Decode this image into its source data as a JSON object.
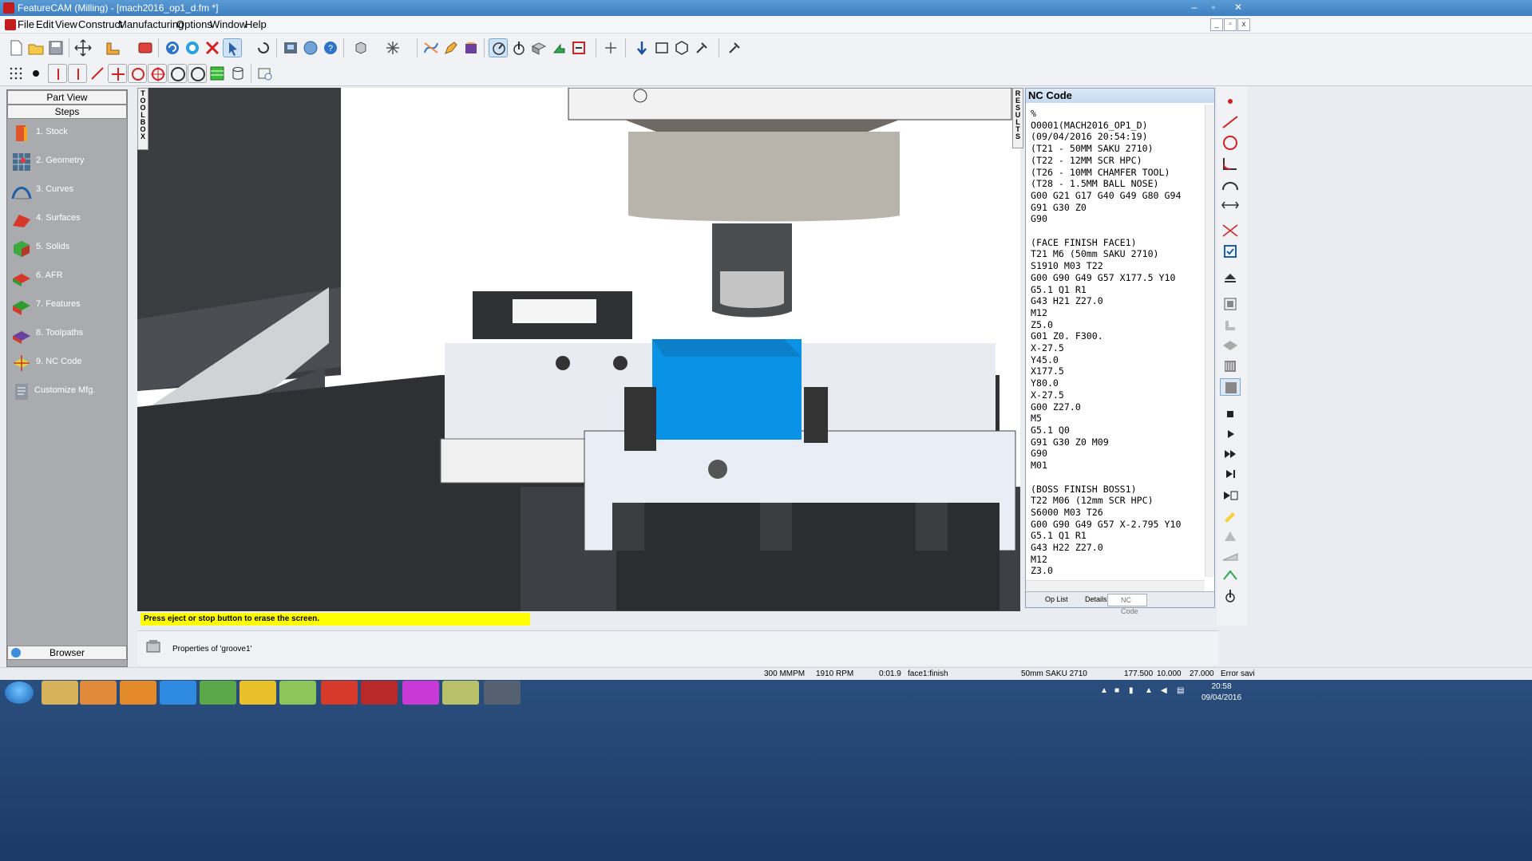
{
  "window": {
    "title": "FeatureCAM (Milling) - [mach2016_op1_d.fm *]",
    "controls": [
      "–",
      "▫",
      "✕"
    ]
  },
  "menu": {
    "items": [
      "File",
      "Edit",
      "View",
      "Construct",
      "Manufacturing",
      "Options",
      "Window",
      "Help"
    ],
    "mdi_controls": [
      "_",
      "▫",
      "x"
    ]
  },
  "left_panel": {
    "part_view": "Part View",
    "steps": "Steps",
    "items": [
      {
        "label": "1.  Stock",
        "icon": "stock-icon"
      },
      {
        "label": "2.  Geometry",
        "icon": "geometry-icon"
      },
      {
        "label": "3.  Curves",
        "icon": "curves-icon"
      },
      {
        "label": "4.  Surfaces",
        "icon": "surfaces-icon"
      },
      {
        "label": "5.  Solids",
        "icon": "solids-icon"
      },
      {
        "label": "6.  AFR",
        "icon": "afr-icon"
      },
      {
        "label": "7.  Features",
        "icon": "features-icon"
      },
      {
        "label": "8.  Toolpaths",
        "icon": "toolpaths-icon"
      },
      {
        "label": "9.  NC Code",
        "icon": "nc-code-icon"
      },
      {
        "label": "Customize Mfg.",
        "icon": "customize-icon"
      }
    ],
    "browser": "Browser"
  },
  "toolbox_tab": "TOOLBOX",
  "results_tab": "RESULTS",
  "nc_panel": {
    "title": "NC Code",
    "code": "%\nO0001(MACH2016_OP1_D)\n(09/04/2016 20:54:19)\n(T21 - 50MM SAKU 2710)\n(T22 - 12MM SCR HPC)\n(T26 - 10MM CHAMFER TOOL)\n(T28 - 1.5MM BALL NOSE)\nG00 G21 G17 G40 G49 G80 G94\nG91 G30 Z0\nG90\n\n(FACE FINISH FACE1)\nT21 M6 (50mm SAKU 2710)\nS1910 M03 T22\nG00 G90 G49 G57 X177.5 Y10\nG5.1 Q1 R1\nG43 H21 Z27.0\nM12\nZ5.0\nG01 Z0. F300.\nX-27.5\nY45.0\nX177.5\nY80.0\nX-27.5\nG00 Z27.0\nM5\nG5.1 Q0\nG91 G30 Z0 M09\nG90\nM01\n\n(BOSS FINISH BOSS1)\nT22 M06 (12mm SCR HPC)\nS6000 M03 T26\nG00 G90 G49 G57 X-2.795 Y10\nG5.1 Q1 R1\nG43 H22 Z27.0\nM12\nZ3.0",
    "tabs": [
      {
        "label": "Op List",
        "icon": "op-list-icon"
      },
      {
        "label": "Details",
        "icon": "details-icon"
      },
      {
        "label": "NC Code",
        "icon": "nc-code-tab-icon"
      }
    ]
  },
  "message": "Press eject or stop button to erase the screen.",
  "properties_label": "Properties of 'groove1'",
  "status": {
    "feed": "300 MMPM",
    "rpm": "1910 RPM",
    "time": "0:01.9",
    "op": "face1:finish",
    "tool": "50mm SAKU 2710",
    "x": "177.500",
    "y": "10.000",
    "z": "27.000",
    "msg": "Error savi"
  },
  "clock": {
    "time": "20:58",
    "date": "09/04/2016"
  },
  "colors": {
    "stock": "#0a93e6",
    "machine_dark": "#3a3c3f",
    "panel_bg": "#a9abae",
    "title_blue": "#3e7fc0",
    "message_yellow": "#ffff00"
  }
}
